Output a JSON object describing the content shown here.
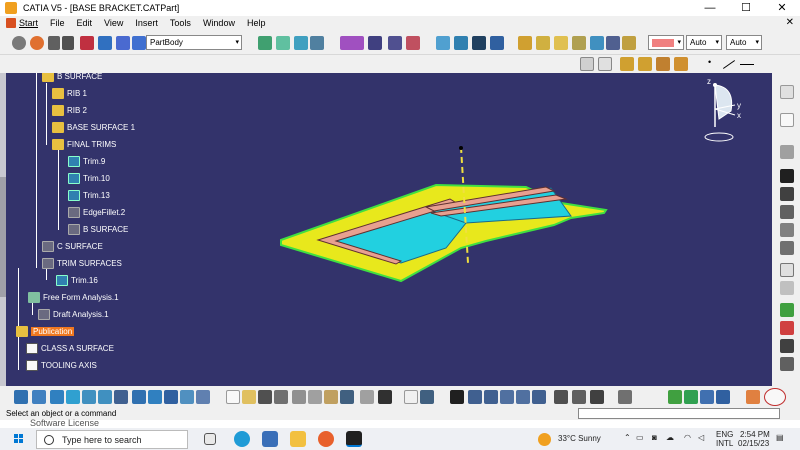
{
  "window": {
    "title": "CATIA V5 - [BASE BRACKET.CATPart]",
    "controls": {
      "minimize": "—",
      "maximize": "☐",
      "close": "✕"
    },
    "mdi_close": "✕"
  },
  "menu": {
    "start": "Start",
    "items": [
      "File",
      "Edit",
      "View",
      "Insert",
      "Tools",
      "Window",
      "Help"
    ]
  },
  "toolbar": {
    "body_select": "PartBody",
    "color_select": "",
    "linetype_select": "Auto",
    "lineweight_select": "Auto",
    "dot_label": "•"
  },
  "tree": {
    "nodes": [
      {
        "label": "B SURFACE",
        "icon": "surface-set-icon"
      },
      {
        "label": "RIB 1",
        "icon": "rib-icon"
      },
      {
        "label": "RIB 2",
        "icon": "rib-icon"
      },
      {
        "label": "BASE SURFACE 1",
        "icon": "surface-icon"
      },
      {
        "label": "FINAL TRIMS",
        "icon": "geometrical-set-icon"
      },
      {
        "label": "Trim.9",
        "icon": "trim-icon"
      },
      {
        "label": "Trim.10",
        "icon": "trim-icon"
      },
      {
        "label": "Trim.13",
        "icon": "trim-icon"
      },
      {
        "label": "EdgeFillet.2",
        "icon": "edge-fillet-icon"
      },
      {
        "label": "B SURFACE",
        "icon": "surface-icon"
      },
      {
        "label": "C SURFACE",
        "icon": "geometrical-set-icon"
      },
      {
        "label": "TRIM SURFACES",
        "icon": "geometrical-set-icon"
      },
      {
        "label": "Trim.16",
        "icon": "trim-icon"
      },
      {
        "label": "Free Form Analysis.1",
        "icon": "analysis-icon"
      },
      {
        "label": "Draft Analysis.1",
        "icon": "draft-analysis-icon"
      },
      {
        "label": "Publication",
        "icon": "publication-icon"
      },
      {
        "label": "CLASS A SURFACE",
        "icon": "parameter-icon"
      },
      {
        "label": "TOOLING AXIS",
        "icon": "parameter-icon"
      }
    ]
  },
  "compass": {
    "z": "z",
    "y": "y",
    "x": "x"
  },
  "status": {
    "message": "Select an object or a command",
    "command_input": ""
  },
  "background_window": {
    "text": "Software License"
  },
  "taskbar": {
    "search_placeholder": "Type here to search",
    "weather": "33°C  Sunny",
    "lang1": "ENG",
    "lang2": "INTL",
    "time": "2:54 PM",
    "date": "02/15/23"
  },
  "colors": {
    "viewport_bg": "#33336b",
    "surface_yellow": "#e8e81c",
    "surface_cyan": "#22d0e0",
    "surface_pink": "#e8a090",
    "edge_green": "#40e040",
    "axis_yellow": "#f0e040",
    "publication_highlight": "#f07820"
  }
}
